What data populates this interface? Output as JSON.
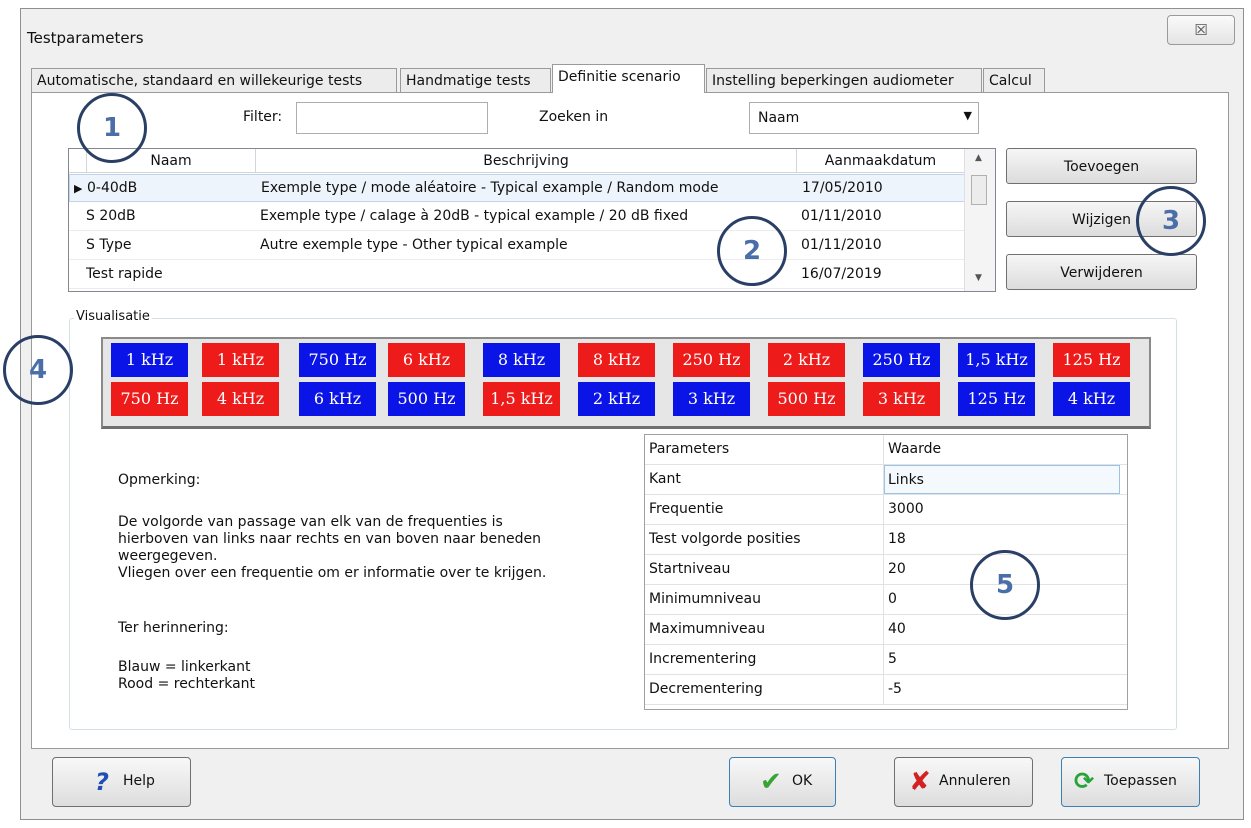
{
  "window": {
    "title": "Testparameters",
    "close_glyph": "☒"
  },
  "tabs": [
    {
      "label": "Automatische, standaard en willekeurige tests"
    },
    {
      "label": "Handmatige tests"
    },
    {
      "label": "Definitie scenario"
    },
    {
      "label": "Instelling beperkingen audiometer"
    },
    {
      "label": "Calcul"
    }
  ],
  "filter": {
    "label": "Filter:",
    "value": "",
    "search_in_label": "Zoeken in",
    "search_in_value": "Naam"
  },
  "grid": {
    "columns": [
      "Naam",
      "Beschrijving",
      "Aanmaakdatum"
    ],
    "rows": [
      {
        "name": "0-40dB",
        "description": "Exemple type / mode aléatoire - Typical example / Random mode",
        "date": "17/05/2010"
      },
      {
        "name": "S 20dB",
        "description": "Exemple type / calage à 20dB - typical example / 20 dB fixed",
        "date": "01/11/2010"
      },
      {
        "name": "S Type",
        "description": "Autre exemple type - Other typical example",
        "date": "01/11/2010"
      },
      {
        "name": "Test rapide",
        "description": "",
        "date": "16/07/2019"
      }
    ]
  },
  "side_buttons": {
    "add": "Toevoegen",
    "edit": "Wijzigen",
    "delete": "Verwijderen"
  },
  "visualisatie": {
    "label": "Visualisatie",
    "row1": [
      {
        "text": "1 kHz",
        "side": "blue"
      },
      {
        "text": "1 kHz",
        "side": "red"
      },
      {
        "text": "750 Hz",
        "side": "blue"
      },
      {
        "text": "6 kHz",
        "side": "red"
      },
      {
        "text": "8 kHz",
        "side": "blue"
      },
      {
        "text": "8 kHz",
        "side": "red"
      },
      {
        "text": "250 Hz",
        "side": "red"
      },
      {
        "text": "2 kHz",
        "side": "red"
      },
      {
        "text": "250 Hz",
        "side": "blue"
      },
      {
        "text": "1,5 kHz",
        "side": "blue"
      },
      {
        "text": "125 Hz",
        "side": "red"
      }
    ],
    "row2": [
      {
        "text": "750 Hz",
        "side": "red"
      },
      {
        "text": "4 kHz",
        "side": "red"
      },
      {
        "text": "6 kHz",
        "side": "blue"
      },
      {
        "text": "500 Hz",
        "side": "blue"
      },
      {
        "text": "1,5 kHz",
        "side": "red"
      },
      {
        "text": "2 kHz",
        "side": "blue"
      },
      {
        "text": "3 kHz",
        "side": "blue"
      },
      {
        "text": "500 Hz",
        "side": "red"
      },
      {
        "text": "3 kHz",
        "side": "red"
      },
      {
        "text": "125 Hz",
        "side": "blue"
      },
      {
        "text": "4 kHz",
        "side": "blue"
      }
    ]
  },
  "colors": {
    "blue": "#0a14e6",
    "red": "#ee1b1b",
    "callout": "#2a3f66"
  },
  "notes": {
    "heading": "Opmerking:",
    "line1": "De volgorde van passage van elk van de frequenties is",
    "line2": "hierboven van links naar rechts en van boven naar beneden",
    "line3": "weergegeven.",
    "line4": "Vliegen over een frequentie om er informatie over te krijgen.",
    "reminder": "Ter herinnering:",
    "blue": "Blauw = linkerkant",
    "red": "Rood = rechterkant"
  },
  "params": {
    "header": [
      "Parameters",
      "Waarde"
    ],
    "rows": [
      {
        "k": "Kant",
        "v": "Links"
      },
      {
        "k": "Frequentie",
        "v": "3000"
      },
      {
        "k": "Test volgorde posities",
        "v": "18"
      },
      {
        "k": "Startniveau",
        "v": "20"
      },
      {
        "k": "Minimumniveau",
        "v": "0"
      },
      {
        "k": "Maximumniveau",
        "v": "40"
      },
      {
        "k": "Incrementering",
        "v": "5"
      },
      {
        "k": "Decrementering",
        "v": "-5"
      }
    ]
  },
  "callouts": [
    "1",
    "2",
    "3",
    "4",
    "5"
  ],
  "bottom_buttons": {
    "help": "Help",
    "ok": "OK",
    "cancel": "Annuleren",
    "apply": "Toepassen"
  }
}
